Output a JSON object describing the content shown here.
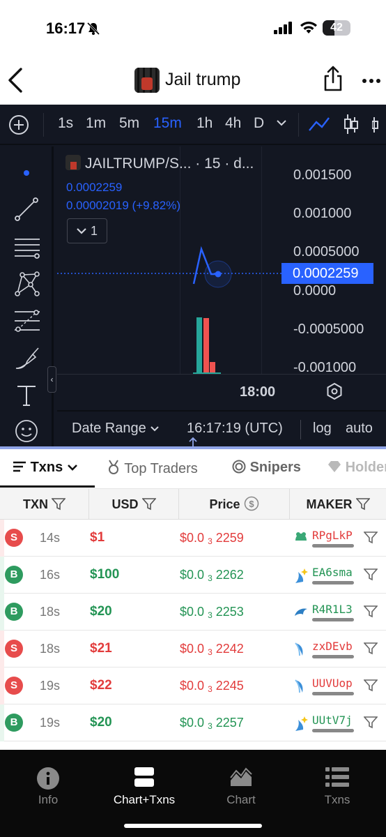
{
  "status_bar": {
    "time": "16:17",
    "battery": "42"
  },
  "nav": {
    "title": "Jail trump"
  },
  "timeframes": [
    {
      "label": "1s",
      "active": false
    },
    {
      "label": "1m",
      "active": false
    },
    {
      "label": "5m",
      "active": false
    },
    {
      "label": "15m",
      "active": true
    },
    {
      "label": "1h",
      "active": false
    },
    {
      "label": "4h",
      "active": false
    },
    {
      "label": "D",
      "active": false
    }
  ],
  "chart": {
    "symbol": "JAILTRUMP/S... · 15 · d...",
    "last_price": "0.0002259",
    "change": "0.00002019 (+9.82%)",
    "collapse_count": "1",
    "y_ticks": [
      "0.001500",
      "0.001000",
      "0.0005000",
      "0.0000",
      "-0.0005000",
      "-0.001000"
    ],
    "price_tag": "0.0002259",
    "x_label": "18:00",
    "date_range": "Date Range",
    "clock": "16:17:19 (UTC)",
    "log_label": "log",
    "auto_label": "auto",
    "colors": {
      "background": "#131722",
      "accent": "#2962ff",
      "volume_up": "#26a69a",
      "volume_down": "#ef5350"
    }
  },
  "tabs": [
    "Txns",
    "Top Traders",
    "Snipers",
    "Holders"
  ],
  "table": {
    "headers": {
      "txn": "TXN",
      "usd": "USD",
      "price": "Price",
      "maker": "MAKER"
    },
    "rows": [
      {
        "side": "S",
        "age": "14s",
        "usd": "$1",
        "price_a": "$0.0",
        "price_sub": "3",
        "price_b": "2259",
        "maker": "RPgLkP",
        "maker_icon": "frog-icon"
      },
      {
        "side": "B",
        "age": "16s",
        "usd": "$100",
        "price_a": "$0.0",
        "price_sub": "3",
        "price_b": "2262",
        "maker": "EA6sma",
        "maker_icon": "sparkle-icon"
      },
      {
        "side": "B",
        "age": "18s",
        "usd": "$20",
        "price_a": "$0.0",
        "price_sub": "3",
        "price_b": "2253",
        "maker": "R4R1L3",
        "maker_icon": "dolphin-icon"
      },
      {
        "side": "S",
        "age": "18s",
        "usd": "$21",
        "price_a": "$0.0",
        "price_sub": "3",
        "price_b": "2242",
        "maker": "zxDEvb",
        "maker_icon": "shrimp-icon"
      },
      {
        "side": "S",
        "age": "19s",
        "usd": "$22",
        "price_a": "$0.0",
        "price_sub": "3",
        "price_b": "2245",
        "maker": "UUVUop",
        "maker_icon": "shrimp-icon"
      },
      {
        "side": "B",
        "age": "19s",
        "usd": "$20",
        "price_a": "$0.0",
        "price_sub": "3",
        "price_b": "2257",
        "maker": "UUtV7j",
        "maker_icon": "sparkle-icon"
      }
    ]
  },
  "bottom_tabs": [
    {
      "label": "Info",
      "active": false
    },
    {
      "label": "Chart+Txns",
      "active": true
    },
    {
      "label": "Chart",
      "active": false
    },
    {
      "label": "Txns",
      "active": false
    }
  ]
}
